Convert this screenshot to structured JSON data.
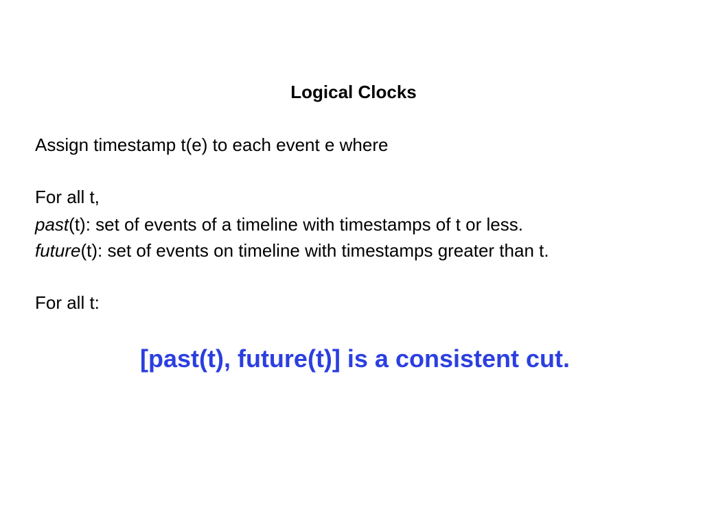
{
  "slide": {
    "title": "Logical Clocks",
    "assign_line": "Assign timestamp t(e) to each event e where",
    "for_all_1": "For all t,",
    "past_term": "past",
    "past_rest": "(t): set of events of a timeline with timestamps of t or less.",
    "future_term": "future",
    "future_rest": "(t): set of events on timeline with timestamps greater than t.",
    "for_all_2": "For all t:",
    "conclusion": "[past(t), future(t)] is a consistent cut.",
    "conclusion_color": "#2b3fe0"
  }
}
